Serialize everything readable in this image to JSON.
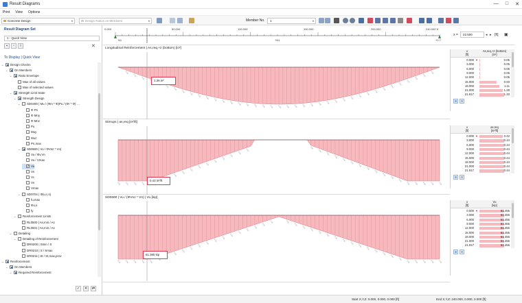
{
  "window": {
    "title": "Result Diagrams",
    "controls": [
      "—",
      "□",
      "✕"
    ]
  },
  "menu": [
    "Print",
    "View",
    "Options"
  ],
  "toolbar": {
    "addon": "Concrete Design",
    "design_ratio": "Design Ratios on Members",
    "member_label": "Member No.",
    "member_value": "1"
  },
  "left_panel": {
    "header": "Result Diagram Set",
    "quick_view": "1 - Quick View",
    "display_header": "To Display | Quick View",
    "tree": [
      {
        "label": "Design Checks",
        "level": 0,
        "exp": "⌄",
        "cb": "partial"
      },
      {
        "label": "On Members",
        "level": 1,
        "exp": "⌄",
        "cb": "partial"
      },
      {
        "label": "Ratio Envelope",
        "level": 2,
        "exp": "⌄",
        "cb": "partial"
      },
      {
        "label": "Max of all values",
        "level": 3,
        "exp": "",
        "cb": "empty"
      },
      {
        "label": "Max of selected values",
        "level": 3,
        "exp": "",
        "cb": "empty"
      },
      {
        "label": "Strength Limit State",
        "level": 2,
        "exp": "⌄",
        "cb": "partial"
      },
      {
        "label": "Strength Design",
        "level": 3,
        "exp": "⌄",
        "cb": "partial"
      },
      {
        "label": "SD0400 | Mu / (Φm * Φ)Pu / (Φr * Φ) …",
        "level": 4,
        "exp": "⌄",
        "cb": "empty"
      },
      {
        "label": "Φ Pn",
        "level": 5,
        "exp": "",
        "cb": "empty"
      },
      {
        "label": "Φ Mny",
        "level": 5,
        "exp": "",
        "cb": "empty"
      },
      {
        "label": "Φ Mnz",
        "level": 5,
        "exp": "",
        "cb": "empty"
      },
      {
        "label": "Pu",
        "level": 5,
        "exp": "",
        "cb": "empty"
      },
      {
        "label": "Muy",
        "level": 5,
        "exp": "",
        "cb": "empty"
      },
      {
        "label": "Muz",
        "level": 5,
        "exp": "",
        "cb": "empty"
      },
      {
        "label": "Pn,max",
        "level": 5,
        "exp": "",
        "cb": "empty"
      },
      {
        "label": "SD0500 | Vu / ΦVnz * Vn)",
        "level": 4,
        "exp": "⌄",
        "cb": "partial"
      },
      {
        "label": "Vu / Φv,Vn",
        "level": 5,
        "exp": "",
        "cb": "empty"
      },
      {
        "label": "Vu / Vmax",
        "level": 5,
        "exp": "",
        "cb": "empty"
      },
      {
        "label": "Vu",
        "level": 5,
        "exp": "",
        "cb": "checked",
        "selected": true
      },
      {
        "label": "Vn",
        "level": 5,
        "exp": "",
        "cb": "empty"
      },
      {
        "label": "Vc",
        "level": 5,
        "exp": "",
        "cb": "empty"
      },
      {
        "label": "Vs",
        "level": 5,
        "exp": "",
        "cb": "empty"
      },
      {
        "label": "Vmax",
        "level": 5,
        "exp": "",
        "cb": "empty"
      },
      {
        "label": "SD0704 | Φ(u,c,s)",
        "level": 4,
        "exp": "⌄",
        "cb": "empty"
      },
      {
        "label": "fu,max",
        "level": 5,
        "exp": "",
        "cb": "empty"
      },
      {
        "label": "Φu,s",
        "level": 5,
        "exp": "",
        "cb": "empty"
      },
      {
        "label": "fy",
        "level": 5,
        "exp": "",
        "cb": "empty"
      },
      {
        "label": "Reinforcement Limits",
        "level": 3,
        "exp": "⌄",
        "cb": "empty"
      },
      {
        "label": "RL0500 | As,min / As",
        "level": 4,
        "exp": "",
        "cb": "empty"
      },
      {
        "label": "RL0601 | As,min / As",
        "level": 4,
        "exp": "",
        "cb": "empty"
      },
      {
        "label": "Detailing",
        "level": 2,
        "exp": "⌄",
        "cb": "empty"
      },
      {
        "label": "Detailing of Reinforcement",
        "level": 3,
        "exp": "⌄",
        "cb": "empty"
      },
      {
        "label": "DR0200 | Smin / S",
        "level": 4,
        "exp": "",
        "cb": "empty"
      },
      {
        "label": "DR0210 | S / Smax",
        "level": 4,
        "exp": "",
        "cb": "empty"
      },
      {
        "label": "DR0211 | St / St,max,prov",
        "level": 4,
        "exp": "",
        "cb": "empty"
      },
      {
        "label": "Reinforcement",
        "level": 0,
        "exp": "⌄",
        "cb": "partial"
      },
      {
        "label": "On Members",
        "level": 1,
        "exp": "⌄",
        "cb": "partial"
      },
      {
        "label": "Required Reinforcement",
        "level": 2,
        "exp": "⌄",
        "cb": "partial"
      }
    ]
  },
  "ruler": {
    "ticks": [
      "0.000",
      "50.000",
      "100.000",
      "150.000",
      "200.000",
      "240.000 ft"
    ],
    "nodes": [
      "N1",
      "N2"
    ],
    "x_label": "x =",
    "x_value": "22.500",
    "x_unit": "[ft]",
    "mid_label": "+N1",
    "end_label": "+2.7"
  },
  "diagrams": [
    {
      "title": "Longitudinal Reinforcement | As,req,+z (bottom) [in²]",
      "tooltip": "1.36 in²",
      "table": {
        "col1": "x\n[ft]",
        "col2": "As,req,+z (bottom)\n[in²]",
        "rows": [
          {
            "x": "0.000",
            "v": "0.05",
            "f": 0.04
          },
          {
            "x": "3.000",
            "v": "0.05",
            "f": 0.04
          },
          {
            "x": "6.000",
            "v": "0.05",
            "f": 0.04
          },
          {
            "x": "9.000",
            "v": "0.05",
            "f": 0.04
          },
          {
            "x": "12.000",
            "v": "0.05",
            "f": 0.04
          },
          {
            "x": "15.000",
            "v": "0.93",
            "f": 0.7
          },
          {
            "x": "18.000",
            "v": "1.11",
            "f": 0.8
          },
          {
            "x": "21.000",
            "v": "1.28",
            "f": 0.95
          },
          {
            "x": "21.917",
            "v": "1.33",
            "f": 1.0
          }
        ]
      }
    },
    {
      "title": "Stirrups | as,req [in²/ft]",
      "tooltip": "0.43 in²/ft",
      "table": {
        "col1": "x\n[ft]",
        "col2": "as,req\n[in²/ft]",
        "rows": [
          {
            "x": "0.000",
            "v": "0.42",
            "f": 0.95
          },
          {
            "x": "3.000",
            "v": "0.44",
            "f": 1.0
          },
          {
            "x": "6.000",
            "v": "0.44",
            "f": 1.0
          },
          {
            "x": "9.000",
            "v": "0.44",
            "f": 1.0
          },
          {
            "x": "12.000",
            "v": "0.44",
            "f": 1.0
          },
          {
            "x": "15.000",
            "v": "0.44",
            "f": 1.0
          },
          {
            "x": "18.000",
            "v": "0.44",
            "f": 1.0
          },
          {
            "x": "21.000",
            "v": "0.44",
            "f": 1.0
          },
          {
            "x": "21.917",
            "v": "0.44",
            "f": 1.0
          }
        ]
      }
    },
    {
      "title": "SD0500 | Vu / (ΦVnz * Vn) | Vu [kip]",
      "tooltip": "61.395 kip",
      "table": {
        "col1": "x\n[ft]",
        "col2": "Vu\n[kip]",
        "rows": [
          {
            "x": "0.000",
            "v": "61.456",
            "f": 1.0
          },
          {
            "x": "3.000",
            "v": "61.456",
            "f": 1.0
          },
          {
            "x": "6.000",
            "v": "61.456",
            "f": 1.0
          },
          {
            "x": "9.000",
            "v": "61.456",
            "f": 1.0
          },
          {
            "x": "12.000",
            "v": "61.456",
            "f": 1.0
          },
          {
            "x": "15.000",
            "v": "61.456",
            "f": 1.0
          },
          {
            "x": "18.000",
            "v": "61.456",
            "f": 1.0
          },
          {
            "x": "21.000",
            "v": "61.456",
            "f": 1.0
          },
          {
            "x": "21.917",
            "v": "61.456",
            "f": 1.0
          }
        ]
      }
    }
  ],
  "status": {
    "start": "Start X,Y,Z: 0.000, 0.000, 0.000 [ft]",
    "end": "End X,Y,Z: 240.000, 0.000, 0.000 [ft]"
  },
  "colors": {
    "fill": "#f6b9be",
    "stroke": "#e07a84",
    "accent": "#3a6fb8",
    "highlight": "#e03a52"
  }
}
